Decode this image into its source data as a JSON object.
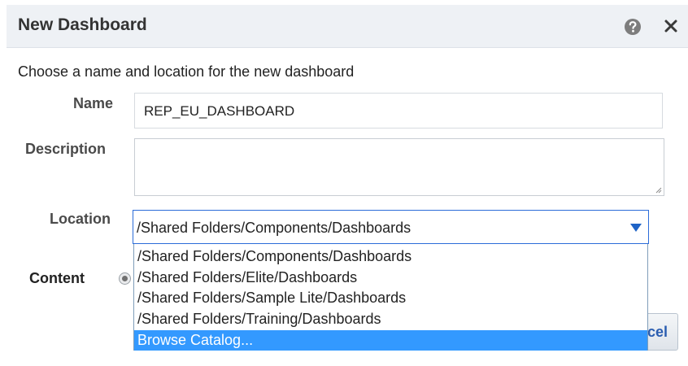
{
  "dialog": {
    "title": "New Dashboard",
    "help_icon": "question-circle-icon",
    "close_icon": "close-x-icon"
  },
  "form": {
    "instruction": "Choose a name and location for the new dashboard",
    "name_label": "Name",
    "name_value": "REP_EU_DASHBOARD",
    "description_label": "Description",
    "description_value": "",
    "location_label": "Location",
    "location_value": "/Shared Folders/Components/Dashboards",
    "content_label": "Content"
  },
  "location_dropdown": {
    "options": [
      "/Shared Folders/Components/Dashboards",
      "/Shared Folders/Elite/Dashboards",
      "/Shared Folders/Sample Lite/Dashboards",
      "/Shared Folders/Training/Dashboards",
      "Browse Catalog..."
    ],
    "highlighted_index": 4
  },
  "buttons": {
    "cancel_label": "Cancel"
  },
  "colors": {
    "titlebar_bg": "#eef1f5",
    "accent_blue": "#2b6cd9",
    "highlight_blue": "#3399ff",
    "cancel_text": "#2a5db0"
  }
}
